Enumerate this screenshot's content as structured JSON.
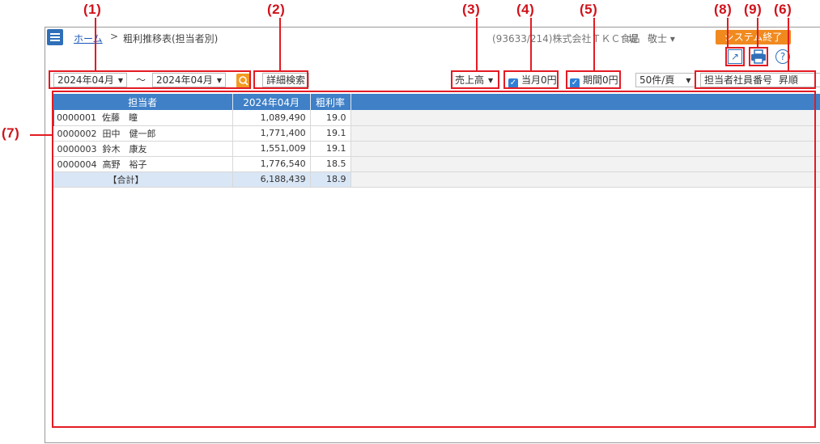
{
  "header": {
    "breadcrumb_home": "ホーム",
    "breadcrumb_sep": ">",
    "page_title": "粗利推移表(担当者別)",
    "company": "(93633/214)株式会社ＴＫＣ食品",
    "user": "堤　敬士",
    "exit_label": "システム終了"
  },
  "toolbar": {
    "period_from": "2024年04月",
    "period_sep": "～",
    "period_to": "2024年04月",
    "detail_search": "詳細検索",
    "measure": "売上高",
    "month_zero_label": "当月0円",
    "period_zero_label": "期間0円",
    "page_size": "50件/頁",
    "sort_key": "担当者社員番号",
    "sort_order": "昇順"
  },
  "annotations": [
    "(1)",
    "(2)",
    "(3)",
    "(4)",
    "(5)",
    "(8)",
    "(9)",
    "(6)",
    "(7)"
  ],
  "table": {
    "headers": [
      "担当者",
      "2024年04月",
      "粗利率"
    ],
    "rows": [
      {
        "code": "0000001",
        "name": "佐藤　瞳",
        "amount": "1,089,490",
        "rate": "19.0"
      },
      {
        "code": "0000002",
        "name": "田中　健一郎",
        "amount": "1,771,400",
        "rate": "19.1"
      },
      {
        "code": "0000003",
        "name": "鈴木　康友",
        "amount": "1,551,009",
        "rate": "19.1"
      },
      {
        "code": "0000004",
        "name": "高野　裕子",
        "amount": "1,776,540",
        "rate": "18.5"
      }
    ],
    "total": {
      "label": "【合計】",
      "amount": "6,188,439",
      "rate": "18.9"
    }
  },
  "colors": {
    "accent": "#3f80c7",
    "annotation": "#e31b23",
    "exit": "#f08a1e"
  }
}
